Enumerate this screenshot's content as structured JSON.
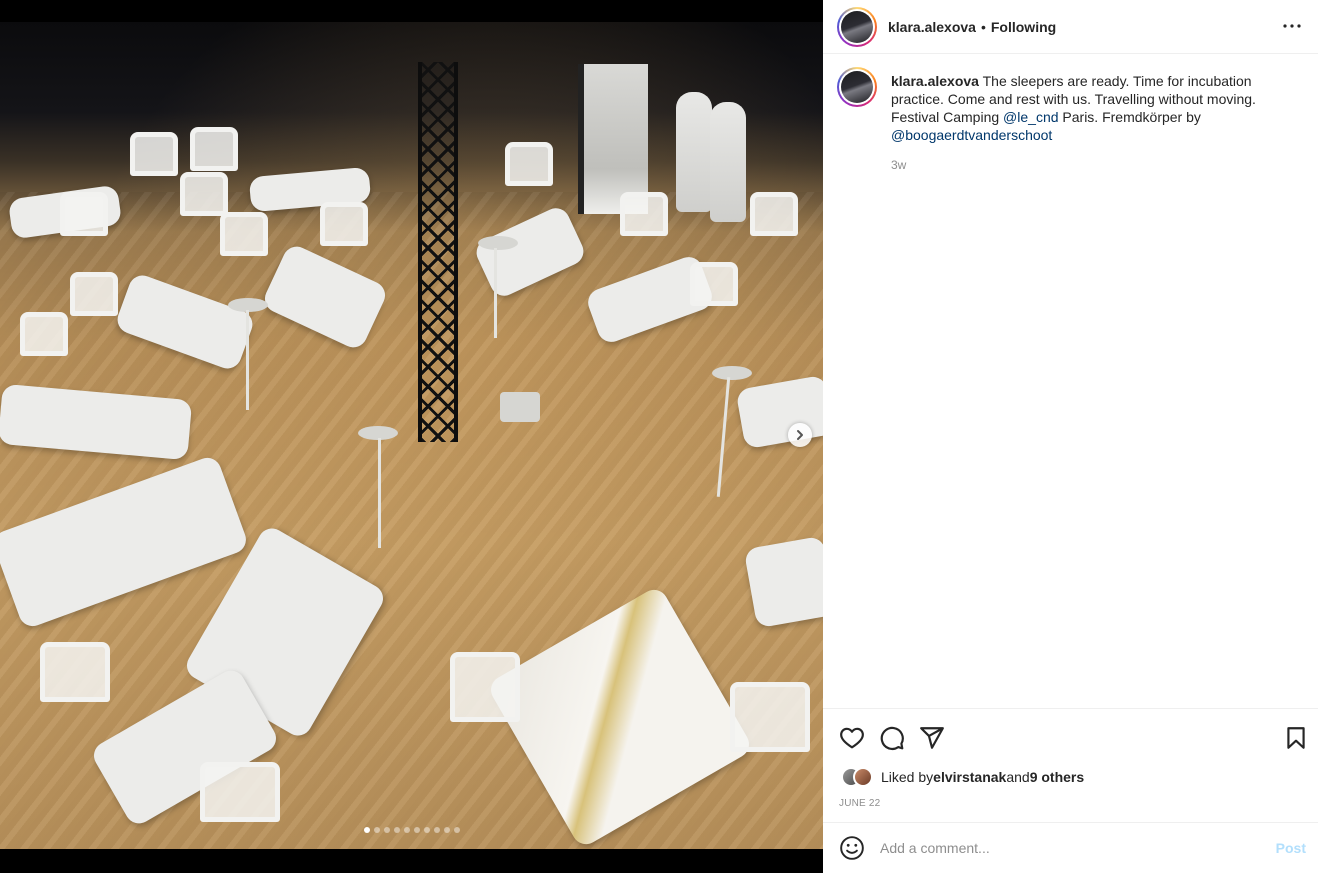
{
  "post": {
    "username": "klara.alexova",
    "separator": "•",
    "follow_status": "Following",
    "more_icon": "more-horizontal-icon"
  },
  "caption": {
    "username": "klara.alexova",
    "text_part1": " The sleepers are ready. Time for incubation practice. Come and rest with us. Travelling without moving. Festival Camping ",
    "mention1": "@le_cnd",
    "text_part2": " Paris. Fremdkörper by ",
    "mention2": "@boogaerdtvanderschoot",
    "time_ago": "3w"
  },
  "media": {
    "description_icon": "carousel-next-icon",
    "carousel_count": 10,
    "carousel_active": 0
  },
  "actions": {
    "like_icon": "heart-icon",
    "comment_icon": "comment-icon",
    "share_icon": "share-icon",
    "save_icon": "bookmark-icon"
  },
  "likes": {
    "prefix": "Liked by ",
    "first_user": "elvirstanak",
    "middle": " and ",
    "others": "9 others"
  },
  "date": "JUNE 22",
  "comment": {
    "placeholder": "Add a comment...",
    "post_label": "Post"
  },
  "colors": {
    "text": "#262626",
    "secondary": "#8e8e8e",
    "link": "#00376b",
    "post_disabled": "#b2dffc",
    "border": "#efefef"
  }
}
